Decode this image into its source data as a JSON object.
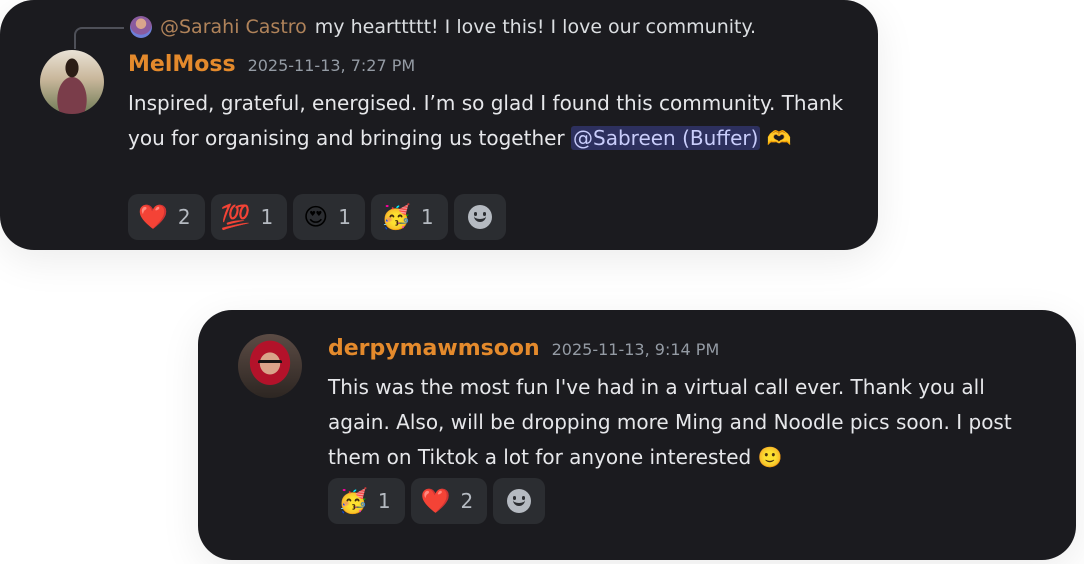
{
  "message1": {
    "reply": {
      "username": "@Sarahi Castro",
      "text": "my hearttttt! I love this! I love our community."
    },
    "username": "MelMoss",
    "timestamp": "2025-11-13, 7:27 PM",
    "text_before": "Inspired, grateful, energised. I’m so glad I found this community. Thank you for organising and bringing us together ",
    "mention": "@Sabreen (Buffer)",
    "text_after": " ",
    "trailing_emoji": "🫶",
    "reactions": [
      {
        "emoji": "❤️",
        "name": "heart",
        "count": "2"
      },
      {
        "emoji": "💯",
        "name": "hundred-points",
        "count": "1"
      },
      {
        "emoji": "😍",
        "name": "heart-eyes",
        "count": "1"
      },
      {
        "emoji": "🥳",
        "name": "partying-face",
        "count": "1"
      }
    ]
  },
  "message2": {
    "username": "derpymawmsoon",
    "timestamp": "2025-11-13, 9:14 PM",
    "text": "This was the most fun I've had in a virtual call ever. Thank you all again. Also, will be dropping more Ming and Noodle pics soon. I post them on Tiktok a lot for anyone interested ",
    "trailing_emoji": "🙂",
    "reactions": [
      {
        "emoji": "🥳",
        "name": "partying-face",
        "count": "1"
      },
      {
        "emoji": "❤️",
        "name": "heart",
        "count": "2"
      }
    ]
  },
  "colors": {
    "card_background": "#1b1b1f",
    "username": "#e48a2c",
    "mention_background": "rgba(88,101,242,0.3)"
  }
}
